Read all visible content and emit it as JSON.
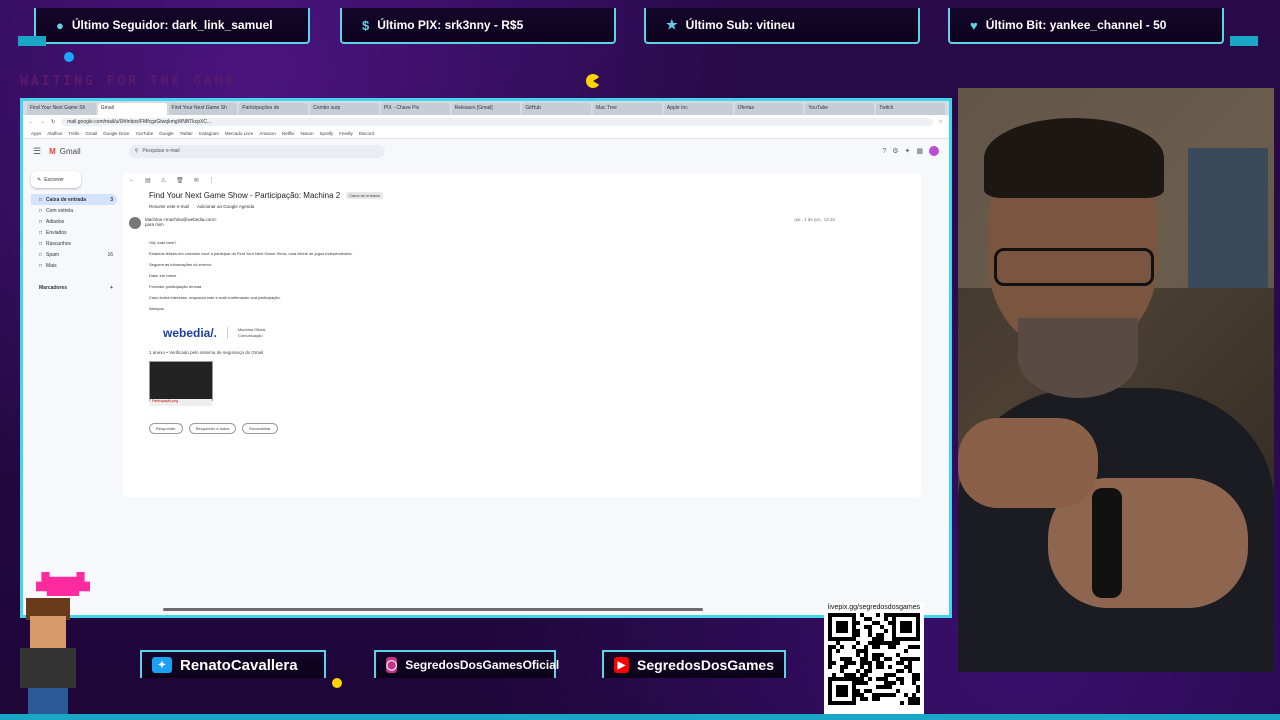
{
  "alerts": {
    "follower": "Último Seguidor: dark_link_samuel",
    "pix": "Último PIX: srk3nny - R$5",
    "sub": "Último Sub: vitineu",
    "bit": "Último Bit: yankee_channel - 50"
  },
  "overlay_text": "WAITING FOR THE GAME",
  "browser": {
    "tabs": [
      "Find Your Next Game Sh",
      "Gmail",
      "Find Your Next Game Sh",
      "Participações de",
      "Combo surp",
      "PIX - Chave Pix",
      "Releases [Gmail]",
      "GitHub",
      "Mac Tree",
      "Apple Inc",
      "Ofertas",
      "YouTube",
      "Twitch"
    ],
    "url": "mail.google.com/mail/u/0/#inbox/FMfcgzGtwqkmgWNBTkcpXC...",
    "bookmarks": [
      "Apps",
      "Atalhos",
      "Trello",
      "Gmail",
      "Google Drive",
      "YouTube",
      "Google",
      "Twitter",
      "Instagram",
      "Mercado Livre",
      "Amazon",
      "Netflix",
      "Notion",
      "Spotify",
      "Feedly",
      "Discord"
    ]
  },
  "gmail": {
    "brand": "Gmail",
    "search_placeholder": "Pesquisar e-mail",
    "compose": "Escrever",
    "nav": [
      {
        "label": "Caixa de entrada",
        "count": "3"
      },
      {
        "label": "Com estrela",
        "count": ""
      },
      {
        "label": "Adiados",
        "count": ""
      },
      {
        "label": "Enviados",
        "count": ""
      },
      {
        "label": "Rascunhos",
        "count": ""
      },
      {
        "label": "Spam",
        "count": "16"
      },
      {
        "label": "Mais",
        "count": ""
      }
    ],
    "labels_heading": "Marcadores",
    "subject": "Find Your Next Game Show - Participação: Machina 2",
    "subject_chip": "Caixa de entrada",
    "actions": [
      "Resumir este e-mail",
      "Adicionar ao Google Agenda"
    ],
    "sender": "Machina <machina@webedia.com>",
    "sender_to": "para mim",
    "timestamp": "qui., 1 de jun., 14:32",
    "body_greeting": "Olá, tudo bem?",
    "body_lines": [
      "Estamos felizes em convidar você a participar do Find Your Next Game Show, uma vitrine de jogos independentes.",
      "Seguem as informações do evento:",
      "Data: em breve",
      "Formato: participação remota",
      "Caso tenha interesse, responda este e-mail confirmando sua participação.",
      "Abraços,"
    ],
    "signature_logo": "webedia/.",
    "signature_name": "Machina Oficial",
    "signature_role": "Comunicação",
    "attachments_heading": "1 anexo • Verificado pelo sistema de segurança do Gmail",
    "attachment_caption": "Participação.png",
    "reply_buttons": [
      "Responder",
      "Responder a todos",
      "Encaminhar"
    ]
  },
  "social": {
    "twitter": "RenatoCavallera",
    "instagram": "SegredosDosGamesOficial",
    "youtube": "SegredosDosGames"
  },
  "qr_label": "livepix.gg/segredosdosgames",
  "colors": {
    "frame_cyan": "#41d6ec",
    "background_purple": "#2a0a4a",
    "accent_pink": "#ff2a9e",
    "pac_yellow": "#ffd400"
  }
}
